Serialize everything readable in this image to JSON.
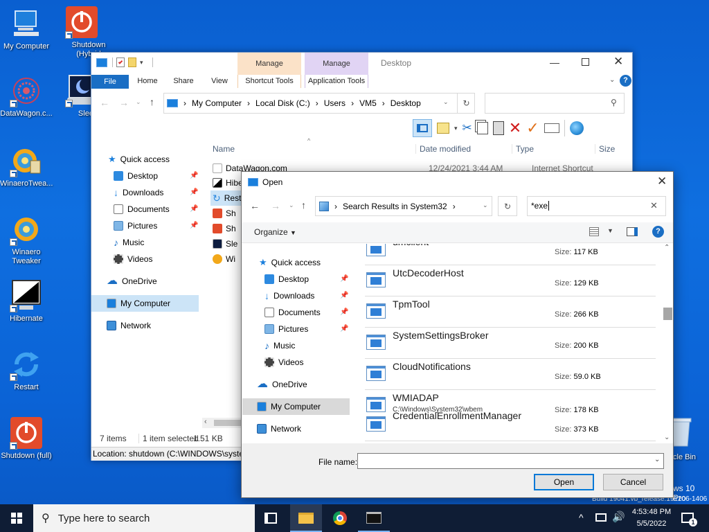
{
  "desktop": {
    "icons": [
      {
        "label": "My Computer",
        "icon": "monitor-icon"
      },
      {
        "label": "Shutdown (Hybrid",
        "icon": "power-icon"
      },
      {
        "label": "DataWagon.c...",
        "icon": "datawagon-icon"
      },
      {
        "label": "Sleep",
        "icon": "sleep-icon"
      },
      {
        "label": "WinaeroTwea...",
        "icon": "winaero-icon"
      },
      {
        "label": "Winaero Tweaker",
        "icon": "winaero-icon"
      },
      {
        "label": "Hibernate",
        "icon": "hibernate-icon"
      },
      {
        "label": "Restart",
        "icon": "restart-icon"
      },
      {
        "label": "Shutdown (full)",
        "icon": "power-icon"
      },
      {
        "label": "Recycle Bin",
        "icon": "recycle-bin-icon"
      }
    ],
    "recycle_visible": "cle Bin",
    "watermark_line1": "ws 10 Pro",
    "watermark_line2": "Build 19041.vb_release.191206-1406"
  },
  "explorer": {
    "title": "Desktop",
    "tabs": {
      "file": "File",
      "home": "Home",
      "share": "Share",
      "view": "View"
    },
    "context_tabs": [
      {
        "header": "Manage",
        "label": "Shortcut Tools",
        "color": "#fbe2c8"
      },
      {
        "header": "Manage",
        "label": "Application Tools",
        "color": "#e1d4f4"
      }
    ],
    "breadcrumb": [
      "My Computer",
      "Local Disk (C:)",
      "Users",
      "VM5",
      "Desktop"
    ],
    "columns": {
      "name": "Name",
      "date": "Date modified",
      "type": "Type",
      "size": "Size"
    },
    "nav": [
      {
        "label": "Quick access",
        "icon": "star-icon"
      },
      {
        "label": "Desktop",
        "icon": "desktop-folder-icon",
        "pinned": true
      },
      {
        "label": "Downloads",
        "icon": "download-icon",
        "pinned": true
      },
      {
        "label": "Documents",
        "icon": "documents-icon",
        "pinned": true
      },
      {
        "label": "Pictures",
        "icon": "pictures-icon",
        "pinned": true
      },
      {
        "label": "Music",
        "icon": "music-icon"
      },
      {
        "label": "Videos",
        "icon": "videos-icon"
      },
      {
        "label": "OneDrive",
        "icon": "cloud-icon"
      },
      {
        "label": "My Computer",
        "icon": "monitor-icon",
        "selected": true
      },
      {
        "label": "Network",
        "icon": "network-icon"
      }
    ],
    "files": [
      {
        "name": "DataWagon.com",
        "date": "12/24/2021 3:44 AM",
        "type": "Internet Shortcut"
      },
      {
        "name": "Hibe",
        "date": "",
        "type": ""
      },
      {
        "name": "Rest",
        "date": "",
        "type": ""
      },
      {
        "name": "Sh",
        "date": "",
        "type": ""
      },
      {
        "name": "Sh",
        "date": "",
        "type": ""
      },
      {
        "name": "Sle",
        "date": "",
        "type": ""
      },
      {
        "name": "Wi",
        "date": "",
        "type": ""
      }
    ],
    "status": {
      "items": "7 items",
      "selected": "1 item selected",
      "size": "1.51 KB"
    },
    "location_bar": "Location: shutdown (C:\\WINDOWS\\system32)"
  },
  "dialog": {
    "title": "Open",
    "address": "Search Results in System32",
    "search_value": "*exe",
    "organize": "Organize",
    "nav": [
      {
        "label": "Quick access",
        "icon": "star-icon"
      },
      {
        "label": "Desktop",
        "icon": "desktop-folder-icon",
        "pinned": true
      },
      {
        "label": "Downloads",
        "icon": "download-icon",
        "pinned": true
      },
      {
        "label": "Documents",
        "icon": "documents-icon",
        "pinned": true
      },
      {
        "label": "Pictures",
        "icon": "pictures-icon",
        "pinned": true
      },
      {
        "label": "Music",
        "icon": "music-icon"
      },
      {
        "label": "Videos",
        "icon": "videos-icon"
      },
      {
        "label": "OneDrive",
        "icon": "cloud-icon"
      },
      {
        "label": "My Computer",
        "icon": "monitor-icon",
        "selected": true
      },
      {
        "label": "Network",
        "icon": "network-icon"
      }
    ],
    "size_label": "Size:",
    "files": [
      {
        "name": "umclient",
        "size": "117 KB",
        "path": ""
      },
      {
        "name": "UtcDecoderHost",
        "size": "129 KB",
        "path": ""
      },
      {
        "name": "TpmTool",
        "size": "266 KB",
        "path": ""
      },
      {
        "name": "SystemSettingsBroker",
        "size": "200 KB",
        "path": ""
      },
      {
        "name": "CloudNotifications",
        "size": "59.0 KB",
        "path": ""
      },
      {
        "name": "WMIADAP",
        "size": "178 KB",
        "path": "C:\\Windows\\System32\\wbem"
      },
      {
        "name": "CredentialEnrollmentManager",
        "size": "373 KB",
        "path": ""
      }
    ],
    "filename_label": "File name:",
    "filename_value": "",
    "open_button": "Open",
    "cancel_button": "Cancel"
  },
  "taskbar": {
    "search_placeholder": "Type here to search",
    "time": "4:53:48 PM",
    "date": "5/5/2022",
    "notification_count": "1"
  }
}
